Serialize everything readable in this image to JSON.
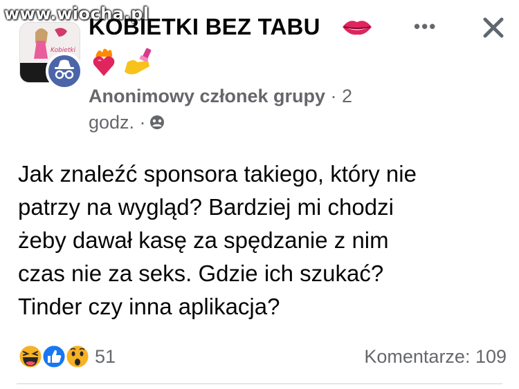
{
  "watermark": "www.wiocha.pl",
  "header": {
    "group_name": "KOBIETKI BEZ TABU",
    "title_icons": [
      "lips-icon",
      "fire-heart-icon",
      "nail-polish-icon"
    ],
    "group_avatar_text": "Kobietki",
    "more_icon": "more-icon",
    "close_icon": "close-icon"
  },
  "meta": {
    "author": "Anonimowy członek grupy",
    "time_part1": " · 2",
    "time_part2": "godz. ·",
    "privacy_icon": "group-privacy-icon"
  },
  "post": {
    "lines": [
      "Jak znaleźć sponsora takiego, który nie",
      "patrzy na wygląd? Bardziej mi chodzi",
      "żeby dawał kasę za spędzanie z nim",
      "czas nie za seks. Gdzie ich szukać?",
      "Tinder czy inna aplikacja?"
    ]
  },
  "footer": {
    "reaction_icons": [
      "haha-icon",
      "like-icon",
      "wow-icon"
    ],
    "reaction_count": "51",
    "comments": "Komentarze: 109"
  },
  "colors": {
    "text": "#050505",
    "meta": "#65676b",
    "like_blue": "#1877f2",
    "emoji_yellow": "#f7b125",
    "anon_avatar": "#4c65a8"
  }
}
